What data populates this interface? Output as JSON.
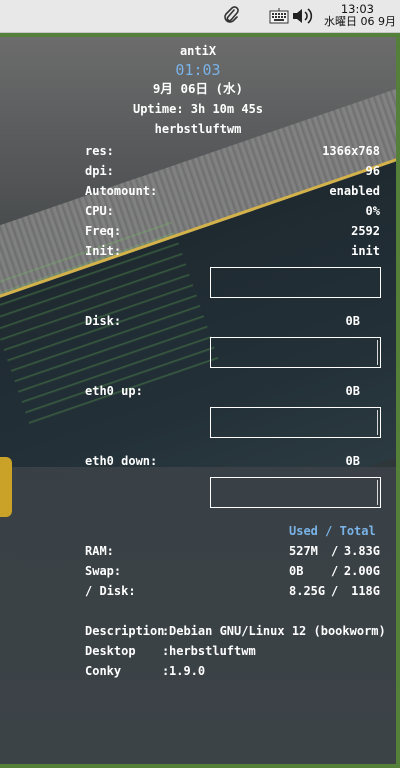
{
  "panel": {
    "time": "13:03",
    "date": "水曜日 06 9月",
    "icons": [
      "paperclip-icon",
      "keyboard-icon",
      "volume-icon"
    ]
  },
  "conky": {
    "title": "antiX",
    "clock": "01:03",
    "date": "9月 06日 (水)",
    "uptime": "Uptime: 3h 10m 45s",
    "wm": "herbstluftwm",
    "system": [
      {
        "label": "res:",
        "value": "1366x768"
      },
      {
        "label": "dpi:",
        "value": "96"
      },
      {
        "label": "Automount:",
        "value": "enabled"
      },
      {
        "label": "CPU:",
        "value": "0%"
      },
      {
        "label": "Freq:",
        "value": "2592"
      },
      {
        "label": "Init:",
        "value": "init"
      }
    ],
    "io": [
      {
        "label": "Disk:",
        "value": "0B"
      },
      {
        "label": "eth0 up:",
        "value": "0B"
      },
      {
        "label": "eth0 down:",
        "value": "0B"
      }
    ],
    "memory_header": {
      "used": "Used",
      "sep": "/",
      "total": "Total"
    },
    "memory": [
      {
        "label": "RAM:",
        "used": "527M",
        "sep": "/",
        "total": "3.83G"
      },
      {
        "label": "Swap:",
        "used": "0B",
        "sep": "/",
        "total": "2.00G"
      },
      {
        "label": "/ Disk:",
        "used": "8.25G",
        "sep": "/",
        "total": "118G"
      }
    ],
    "info": [
      {
        "label": "Description",
        "value": "Debian GNU/Linux 12 (bookworm)"
      },
      {
        "label": "Desktop",
        "value": "herbstluftwm"
      },
      {
        "label": "Conky",
        "value": "1.9.0"
      }
    ]
  },
  "colors": {
    "frame": "#55803a",
    "accent_blue": "#79b3e8",
    "text": "#ffffff",
    "panel": "#e8e8e8"
  }
}
